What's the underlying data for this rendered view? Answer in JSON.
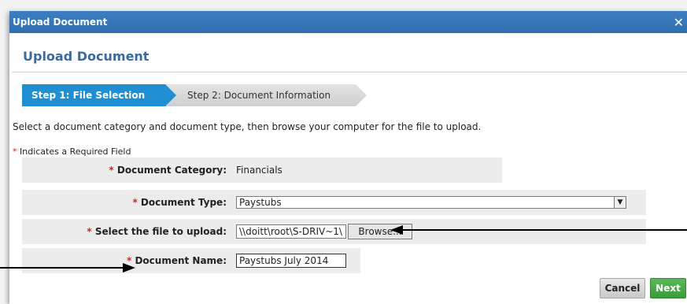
{
  "dialog": {
    "title": "Upload Document",
    "close_icon": "close-icon"
  },
  "heading": "Upload Document",
  "steps": [
    {
      "label": "Step 1: File Selection",
      "active": true
    },
    {
      "label": "Step 2: Document Information",
      "active": false
    }
  ],
  "instructions": "Select a document category and document type, then browse your computer for the file to upload.",
  "required_note": {
    "star": "*",
    "text": " Indicates a Required Field"
  },
  "form": {
    "category": {
      "label": "Document Category:",
      "value": "Financials"
    },
    "type": {
      "label": "Document Type:",
      "value": "Paystubs"
    },
    "file": {
      "label": "Select the file to upload:",
      "path": "\\\\doitt\\root\\S-DRIV~1\\",
      "browse_label": "Browse..."
    },
    "name": {
      "label": "Document Name:",
      "value": "Paystubs July 2014"
    }
  },
  "buttons": {
    "cancel": "Cancel",
    "next": "Next"
  },
  "colors": {
    "accent": "#1f8fd2",
    "titlebar": "#2f6fae",
    "next": "#3a9a3a",
    "required": "#dd2222"
  }
}
